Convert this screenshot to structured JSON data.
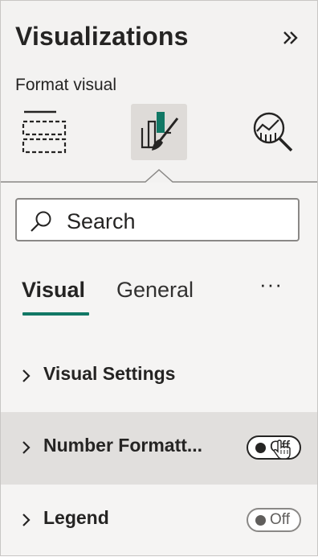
{
  "pane": {
    "title": "Visualizations",
    "subtitle": "Format visual",
    "collapse_icon": "double-chevron-right-icon"
  },
  "viz_buttons": [
    {
      "icon": "build-visual-icon"
    },
    {
      "icon": "format-visual-icon",
      "selected": true
    },
    {
      "icon": "analytics-icon"
    }
  ],
  "search": {
    "placeholder": "Search"
  },
  "tabs": {
    "visual": "Visual",
    "general": "General",
    "more": "···",
    "active": "Visual"
  },
  "sections": [
    {
      "label": "Visual Settings"
    },
    {
      "label": "Number Formatt...",
      "toggle": "Off",
      "state": "off"
    },
    {
      "label": "Legend",
      "toggle": "Off",
      "state": "off"
    }
  ],
  "colors": {
    "accent": "#117865",
    "pane_bg": "#f3f2f1",
    "selected_bg": "#dedbd8",
    "hover_bg": "#e1dfdd",
    "text": "#252423"
  }
}
